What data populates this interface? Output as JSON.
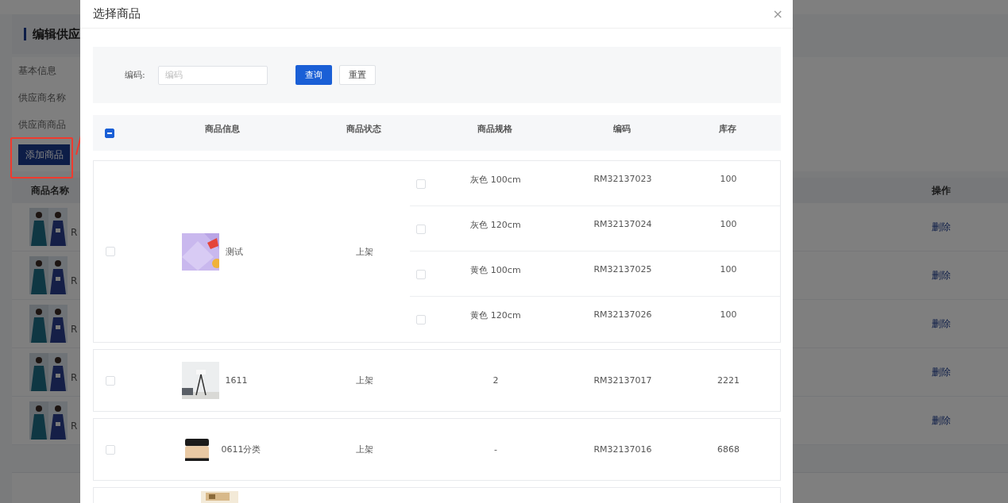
{
  "page": {
    "title": "编辑供应",
    "section": "基本信息",
    "supplier_label": "供应商名称",
    "goods_label": "供应商商品",
    "add_button": "添加商品",
    "table": {
      "columns": [
        "商品名称",
        "操作"
      ],
      "rows": [
        {
          "image": {
            "kind": "picture"
          },
          "code": "R",
          "action": "删除"
        },
        {
          "image": {
            "kind": "picture"
          },
          "code": "R",
          "action": "删除"
        },
        {
          "image": {
            "kind": "picture"
          },
          "code": "R",
          "action": "删除"
        },
        {
          "image": {
            "kind": "picture"
          },
          "code": "R",
          "action": "删除"
        },
        {
          "image": {
            "kind": "picture"
          },
          "code": "R",
          "action": "删除"
        }
      ]
    }
  },
  "dialog": {
    "title": "选择商品",
    "close": "×",
    "search": {
      "label": "编码:",
      "placeholder": "编码",
      "query_button": "查询",
      "reset_button": "重置"
    },
    "select_all": {
      "indeterminate": true
    },
    "columns": [
      "商品信息",
      "商品状态",
      "商品规格",
      "编码",
      "库存"
    ],
    "products": [
      {
        "kind": "multi",
        "checked": false,
        "image": {
          "kind": "picture"
        },
        "name": "测试",
        "status": "上架",
        "skus": [
          {
            "checked": false,
            "spec": "灰色 100cm",
            "code": "RM32137023",
            "stock": "100"
          },
          {
            "checked": false,
            "spec": "灰色 120cm",
            "code": "RM32137024",
            "stock": "100"
          },
          {
            "checked": false,
            "spec": "黄色 100cm",
            "code": "RM32137025",
            "stock": "100"
          },
          {
            "checked": false,
            "spec": "黄色 120cm",
            "code": "RM32137026",
            "stock": "100"
          }
        ]
      },
      {
        "kind": "single",
        "checked": false,
        "image": {
          "kind": "picture"
        },
        "name": "1611",
        "status": "上架",
        "skus": [
          {
            "spec": "2",
            "code": "RM32137017",
            "stock": "2221"
          }
        ]
      },
      {
        "kind": "single",
        "checked": false,
        "image": {
          "kind": "picture"
        },
        "name": "0611分类",
        "status": "上架",
        "skus": [
          {
            "spec": "-",
            "code": "RM32137016",
            "stock": "6868"
          }
        ]
      },
      {
        "kind": "partial",
        "image": {
          "kind": "picture"
        }
      }
    ]
  }
}
